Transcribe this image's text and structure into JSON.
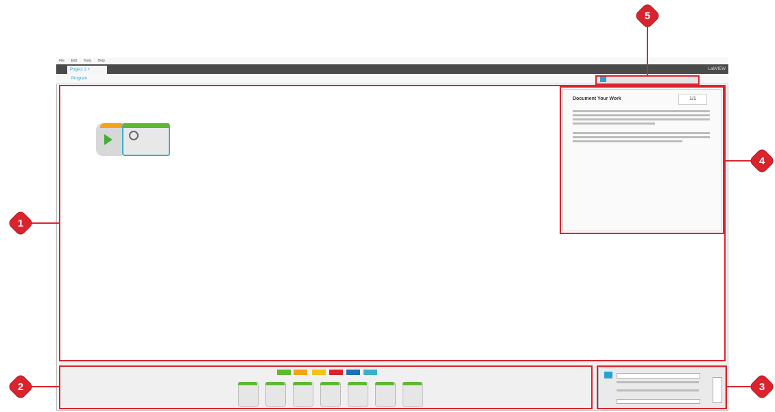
{
  "callouts": [
    {
      "label": "1",
      "role": "programming-canvas"
    },
    {
      "label": "2",
      "role": "programming-palettes"
    },
    {
      "label": "3",
      "role": "hardware-page"
    },
    {
      "label": "4",
      "role": "content-editor"
    },
    {
      "label": "5",
      "role": "programming-toolbar"
    }
  ],
  "app": {
    "menu": [
      "File",
      "Edit",
      "Tools",
      "Help"
    ],
    "tab_label": "Project 1 ×",
    "brand": "LabVIEW",
    "program_tab": "Program"
  },
  "editor": {
    "title": "Document Your Work",
    "page": "1/1"
  },
  "colors": {
    "callout": "#d9242e",
    "accent": "#2aa1d4",
    "palette_tabs": [
      "#5fb831",
      "#f3a319",
      "#f0c419",
      "#d9242e",
      "#1f6fb5",
      "#3ab0c3"
    ]
  }
}
